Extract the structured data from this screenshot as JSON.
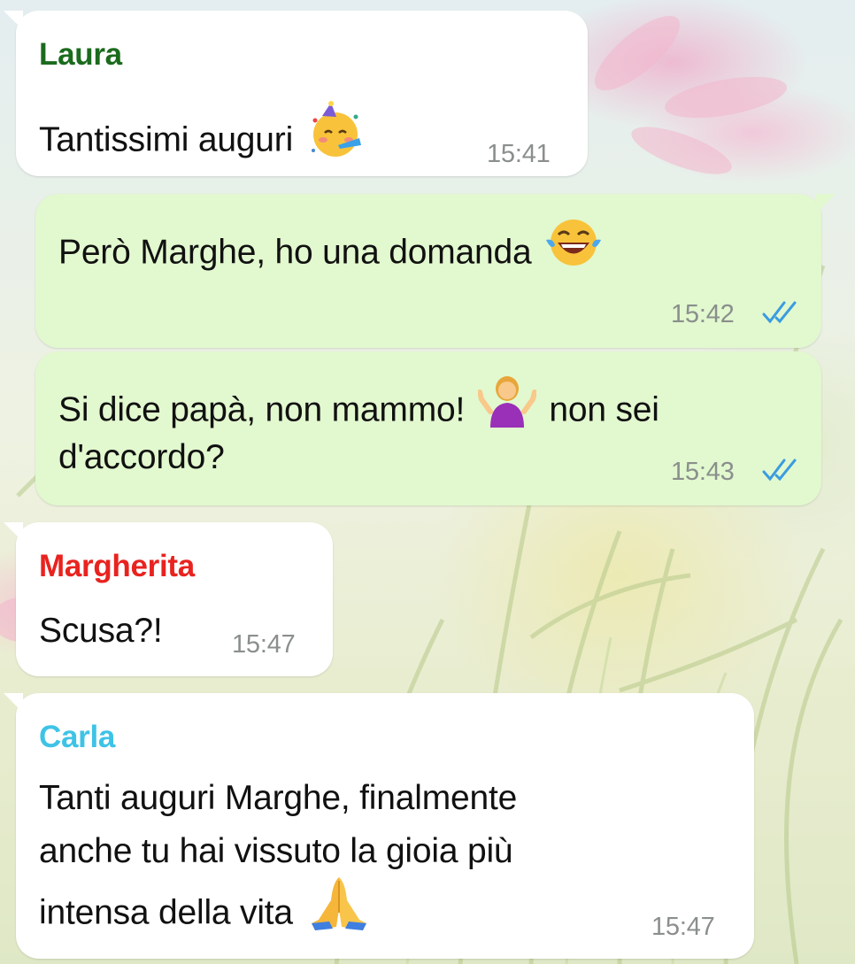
{
  "colors": {
    "incoming_bubble": "#ffffff",
    "outgoing_bubble": "#e2f8cf",
    "read_ticks": "#3a9ce0",
    "timestamp": "#8a8f8c",
    "sender_laura": "#1b6b1e",
    "sender_margherita": "#e8231f",
    "sender_carla": "#3ec3e6"
  },
  "messages": [
    {
      "direction": "incoming",
      "sender": "Laura",
      "text": "Tantissimi auguri",
      "emoji": "partying-face-icon",
      "time": "15:41"
    },
    {
      "direction": "outgoing",
      "text": "Però Marghe, ho una domanda",
      "emoji": "face-with-tears-of-joy-icon",
      "time": "15:42",
      "status": "read"
    },
    {
      "direction": "outgoing",
      "text_line1_a": "Si dice papà, non mammo!",
      "text_line1_b": "non sei",
      "text_line2": "d'accordo?",
      "emoji": "woman-shrugging-icon",
      "time": "15:43",
      "status": "read"
    },
    {
      "direction": "incoming",
      "sender": "Margherita",
      "text": "Scusa?!",
      "time": "15:47"
    },
    {
      "direction": "incoming",
      "sender": "Carla",
      "text_line1": "Tanti auguri Marghe, finalmente",
      "text_line2": "anche tu hai vissuto la gioia più",
      "text_line3": "intensa della vita",
      "emoji": "folded-hands-icon",
      "time": "15:47"
    }
  ]
}
